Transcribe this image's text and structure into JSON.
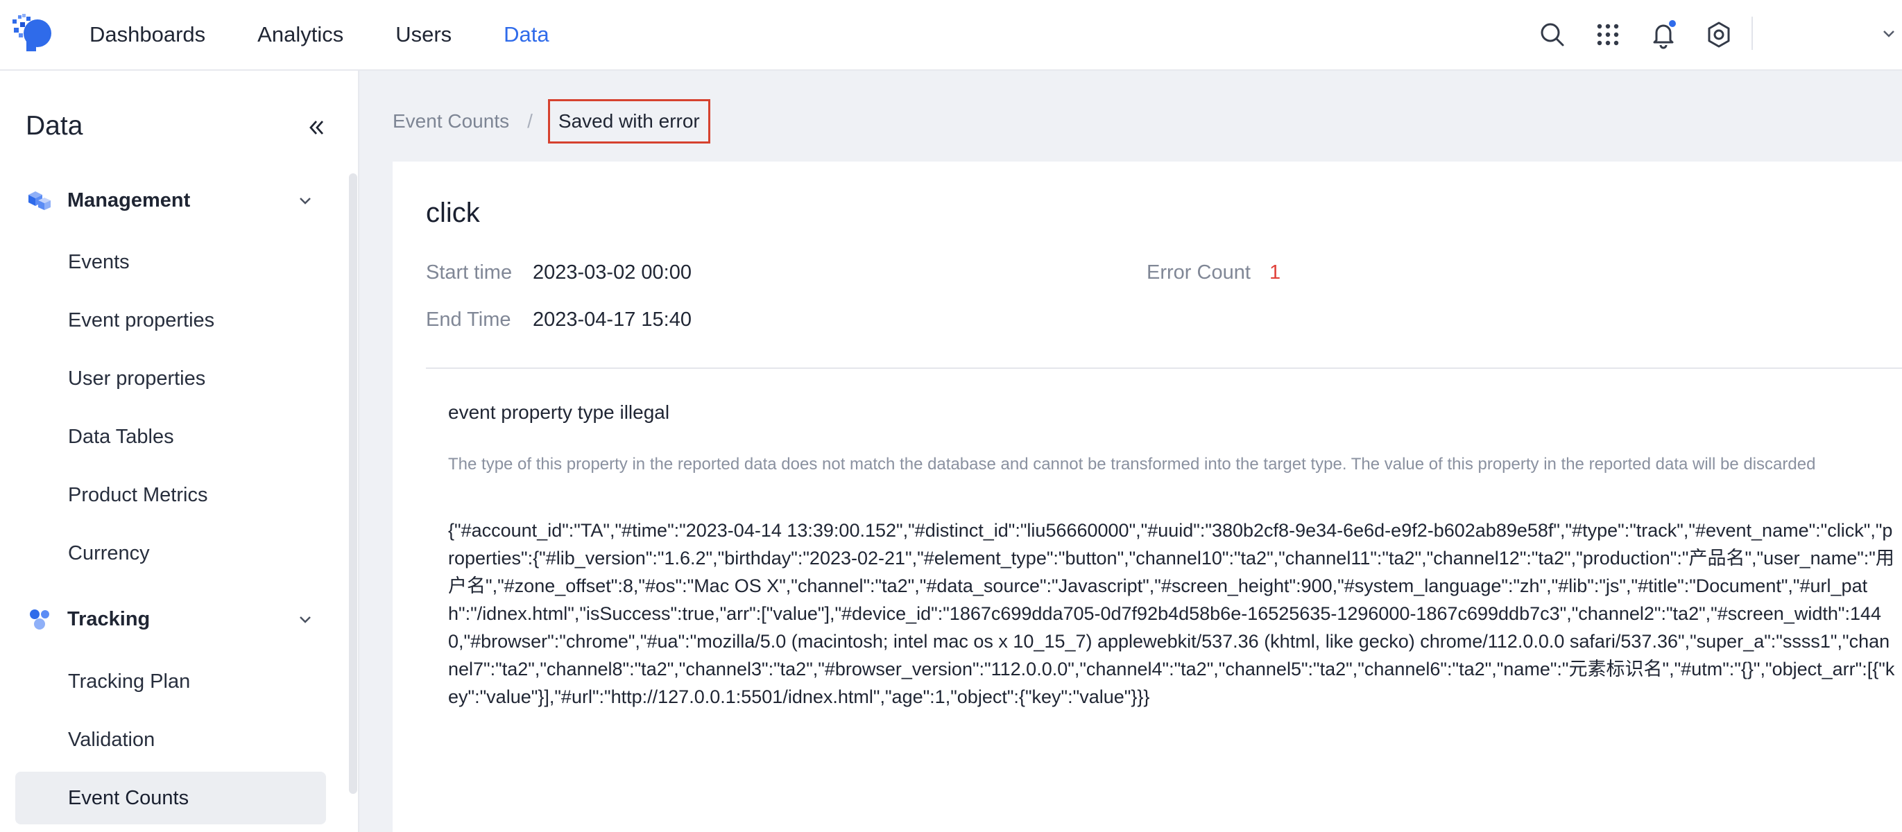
{
  "nav": {
    "items": [
      {
        "label": "Dashboards",
        "active": false
      },
      {
        "label": "Analytics",
        "active": false
      },
      {
        "label": "Users",
        "active": false
      },
      {
        "label": "Data",
        "active": true
      }
    ],
    "icons": [
      "search-icon",
      "apps-grid-icon",
      "bell-icon",
      "settings-icon",
      "chevron-down-icon"
    ],
    "notification_dot_color": "#2f6bea"
  },
  "sidebar": {
    "title": "Data",
    "groups": [
      {
        "label": "Management",
        "icon": "cubes-icon",
        "items": [
          "Events",
          "Event properties",
          "User properties",
          "Data Tables",
          "Product Metrics",
          "Currency"
        ]
      },
      {
        "label": "Tracking",
        "icon": "tracking-dots-icon",
        "items": [
          "Tracking Plan",
          "Validation",
          "Event Counts"
        ]
      }
    ],
    "active_item": "Event Counts"
  },
  "breadcrumb": {
    "parent": "Event Counts",
    "separator": "/",
    "current": "Saved with error"
  },
  "detail": {
    "event_name": "click",
    "start_label": "Start time",
    "start_value": "2023-03-02 00:00",
    "end_label": "End Time",
    "end_value": "2023-04-17 15:40",
    "error_count_label": "Error Count",
    "error_count_value": "1",
    "error_title": "event property type illegal",
    "error_description": "The type of this property in the reported data does not match the database and cannot be transformed into the target type. The value of this property in the reported data will be discarded",
    "error_payload": "{\"#account_id\":\"TA\",\"#time\":\"2023-04-14 13:39:00.152\",\"#distinct_id\":\"liu56660000\",\"#uuid\":\"380b2cf8-9e34-6e6d-e9f2-b602ab89e58f\",\"#type\":\"track\",\"#event_name\":\"click\",\"properties\":{\"#lib_version\":\"1.6.2\",\"birthday\":\"2023-02-21\",\"#element_type\":\"button\",\"channel10\":\"ta2\",\"channel11\":\"ta2\",\"channel12\":\"ta2\",\"production\":\"产品名\",\"user_name\":\"用户名\",\"#zone_offset\":8,\"#os\":\"Mac OS X\",\"channel\":\"ta2\",\"#data_source\":\"Javascript\",\"#screen_height\":900,\"#system_language\":\"zh\",\"#lib\":\"js\",\"#title\":\"Document\",\"#url_path\":\"/idnex.html\",\"isSuccess\":true,\"arr\":[\"value\"],\"#device_id\":\"1867c699dda705-0d7f92b4d58b6e-16525635-1296000-1867c699ddb7c3\",\"channel2\":\"ta2\",\"#screen_width\":1440,\"#browser\":\"chrome\",\"#ua\":\"mozilla/5.0 (macintosh; intel mac os x 10_15_7) applewebkit/537.36 (khtml, like gecko) chrome/112.0.0.0 safari/537.36\",\"super_a\":\"ssss1\",\"channel7\":\"ta2\",\"channel8\":\"ta2\",\"channel3\":\"ta2\",\"#browser_version\":\"112.0.0.0\",\"channel4\":\"ta2\",\"channel5\":\"ta2\",\"channel6\":\"ta2\",\"name\":\"元素标识名\",\"#utm\":\"{}\",\"object_arr\":[{\"key\":\"value\"}],\"#url\":\"http://127.0.0.1:5501/idnex.html\",\"age\":1,\"object\":{\"key\":\"value\"}}}"
  }
}
